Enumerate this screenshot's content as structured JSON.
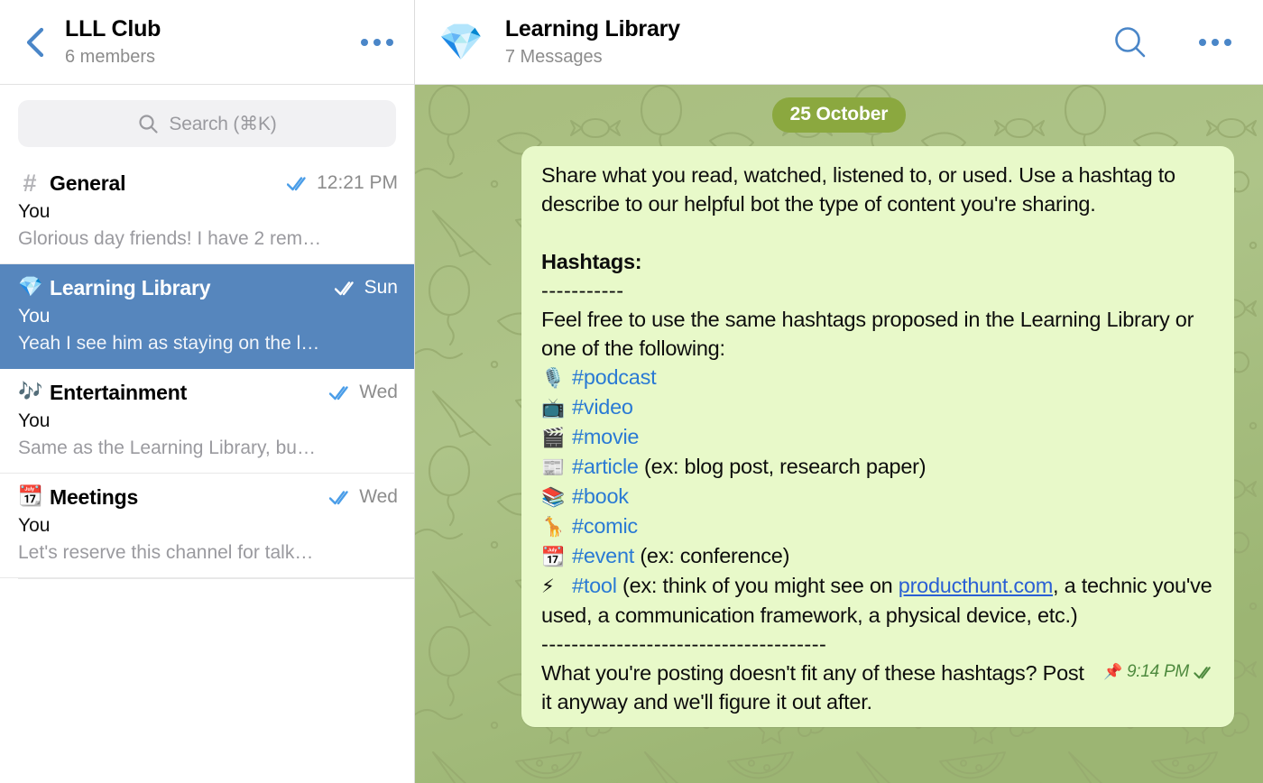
{
  "left_panel": {
    "header": {
      "back_icon": "chevron-left-icon",
      "title": "LLL Club",
      "subtitle": "6 members",
      "menu_icon": "ellipsis-icon"
    },
    "search": {
      "icon": "search-icon",
      "placeholder": "Search (⌘K)",
      "value": ""
    },
    "chats": [
      {
        "emoji": "#",
        "emoji_name": "hash-icon",
        "name": "General",
        "status_icon": "double-check-icon",
        "time": "12:21 PM",
        "from": "You",
        "preview": "Glorious day friends! I have 2 rem…",
        "selected": false
      },
      {
        "emoji": "💎",
        "emoji_name": "gem-icon",
        "name": "Learning Library",
        "status_icon": "double-check-icon",
        "time": "Sun",
        "from": "You",
        "preview": "Yeah I see him as staying on the l…",
        "selected": true
      },
      {
        "emoji": "🎶",
        "emoji_name": "music-notes-icon",
        "name": "Entertainment",
        "status_icon": "double-check-icon",
        "time": "Wed",
        "from": "You",
        "preview": "Same as the Learning Library, bu…",
        "selected": false
      },
      {
        "emoji": "📆",
        "emoji_name": "calendar-icon",
        "name": "Meetings",
        "status_icon": "double-check-icon",
        "time": "Wed",
        "from": "You",
        "preview": "Let's reserve this channel for talk…",
        "selected": false
      }
    ]
  },
  "right_panel": {
    "header": {
      "avatar_emoji": "💎",
      "avatar_name": "gem-icon",
      "title": "Learning Library",
      "subtitle": "7 Messages",
      "search_icon": "search-icon",
      "menu_icon": "ellipsis-icon"
    },
    "date_divider": "25 October",
    "message": {
      "intro": "Share what you read, watched, listened to, or used. Use a hashtag to describe to our helpful bot the type of content you're sharing.",
      "hashtags_heading": "Hashtags:",
      "heading_rule": "-----------",
      "instructions": "Feel free to use the same hashtags proposed in the Learning Library or one of the following:",
      "tags": [
        {
          "emoji": "🎙️",
          "emoji_name": "microphone-icon",
          "tag": "#podcast",
          "note": ""
        },
        {
          "emoji": "📺",
          "emoji_name": "television-icon",
          "tag": "#video",
          "note": ""
        },
        {
          "emoji": "🎬",
          "emoji_name": "clapper-board-icon",
          "tag": "#movie",
          "note": ""
        },
        {
          "emoji": "📰",
          "emoji_name": "newspaper-icon",
          "tag": "#article",
          "note": " (ex: blog post, research paper)"
        },
        {
          "emoji": "📚",
          "emoji_name": "books-icon",
          "tag": "#book",
          "note": ""
        },
        {
          "emoji": "🦒",
          "emoji_name": "giraffe-icon",
          "tag": "#comic",
          "note": ""
        },
        {
          "emoji": "📆",
          "emoji_name": "calendar-icon",
          "tag": "#event",
          "note": " (ex: conference)"
        }
      ],
      "tool_emoji": "⚡",
      "tool_emoji_name": "lightning-bolt-icon",
      "tool_tag": "#tool",
      "tool_text_before": " (ex: think of you might see on ",
      "tool_link": "producthunt.com",
      "tool_text_after": ", a technic you've used, a communication framework, a physical device, etc.)",
      "separator_rule": "--------------------------------------",
      "closing": "What you're posting doesn't fit any of these hashtags? Post it anyway and we'll figure it out after.",
      "pin_icon": "📌",
      "time": "9:14 PM",
      "status_icon": "double-check-icon"
    }
  },
  "colors": {
    "accent_blue": "#4a86c8",
    "selected_row": "#5686bd",
    "bubble_green": "#e8f9c9",
    "wallpaper_green": "#a9bd7f",
    "date_pill": "#8ba83f",
    "hashtag_blue": "#2a7ad4",
    "timestamp_green": "#4e8a3e"
  }
}
